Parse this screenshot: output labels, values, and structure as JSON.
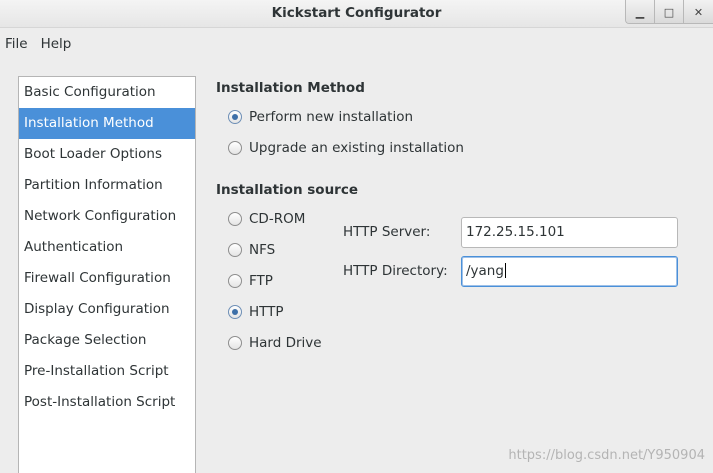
{
  "window": {
    "title": "Kickstart Configurator",
    "controls": [
      "minimize-icon",
      "maximize-icon",
      "close-icon"
    ]
  },
  "menu": {
    "file": "File",
    "help": "Help"
  },
  "sidebar": {
    "items": [
      {
        "label": "Basic Configuration",
        "selected": false
      },
      {
        "label": "Installation Method",
        "selected": true
      },
      {
        "label": "Boot Loader Options",
        "selected": false
      },
      {
        "label": "Partition Information",
        "selected": false
      },
      {
        "label": "Network Configuration",
        "selected": false
      },
      {
        "label": "Authentication",
        "selected": false
      },
      {
        "label": "Firewall Configuration",
        "selected": false
      },
      {
        "label": "Display Configuration",
        "selected": false
      },
      {
        "label": "Package Selection",
        "selected": false
      },
      {
        "label": "Pre-Installation Script",
        "selected": false
      },
      {
        "label": "Post-Installation Script",
        "selected": false
      }
    ]
  },
  "installation_method": {
    "title": "Installation Method",
    "options": [
      {
        "label": "Perform new installation",
        "checked": true
      },
      {
        "label": "Upgrade an existing installation",
        "checked": false
      }
    ]
  },
  "installation_source": {
    "title": "Installation source",
    "options": [
      {
        "label": "CD-ROM",
        "checked": false
      },
      {
        "label": "NFS",
        "checked": false
      },
      {
        "label": "FTP",
        "checked": false
      },
      {
        "label": "HTTP",
        "checked": true
      },
      {
        "label": "Hard Drive",
        "checked": false
      }
    ],
    "http_server_label": "HTTP Server:",
    "http_server_value": "172.25.15.101",
    "http_directory_label": "HTTP Directory:",
    "http_directory_value": "/yang"
  },
  "watermark": "https://blog.csdn.net/Y950904",
  "colors": {
    "selection": "#4a90d9",
    "window_bg": "#ededed"
  }
}
